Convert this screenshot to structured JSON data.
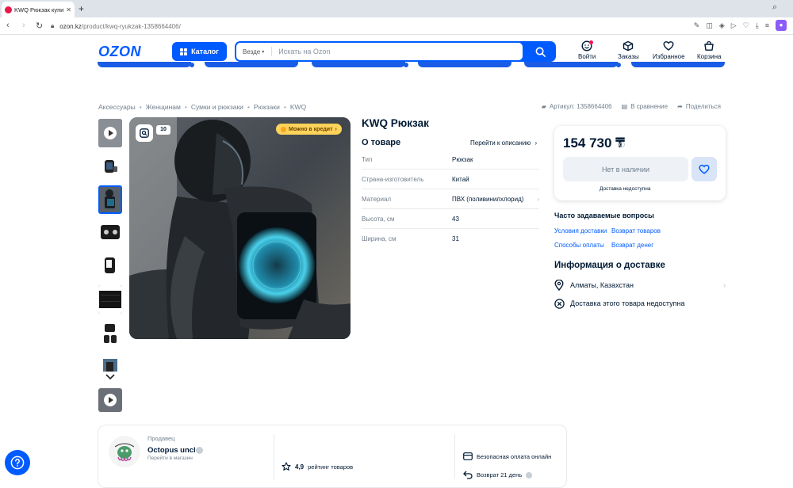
{
  "browser": {
    "tab_title": "KWQ Рюкзак купить на Ozon",
    "url_domain": "ozon.kz",
    "url_path": "/product/kwq-ryukzak-1358664406/"
  },
  "header": {
    "logo": "OZON",
    "catalog_label": "Каталог",
    "search_scope": "Везде",
    "search_placeholder": "Искать на Ozon",
    "nav": [
      {
        "label": "Войти",
        "icon": "user-icon"
      },
      {
        "label": "Заказы",
        "icon": "box-icon"
      },
      {
        "label": "Избранное",
        "icon": "heart-icon"
      },
      {
        "label": "Корзина",
        "icon": "cart-icon"
      }
    ]
  },
  "breadcrumbs": [
    "Аксессуары",
    "Женщинам",
    "Сумки и рюкзаки",
    "Рюкзаки",
    "KWQ"
  ],
  "top_actions": {
    "article": "Артикул: 1358664406",
    "compare": "В сравнение",
    "share": "Поделиться"
  },
  "gallery": {
    "credit_badge": "Можно в кредит",
    "ten_badge": "10"
  },
  "product": {
    "title": "KWQ Рюкзак",
    "about_title": "О товаре",
    "goto_description": "Перейти к описанию",
    "specs": [
      {
        "key": "Тип",
        "value": "Рюкзак"
      },
      {
        "key": "Страна-изготовитель",
        "value": "Китай"
      },
      {
        "key": "Материал",
        "value": "ПВХ (поливинилхлорид)"
      },
      {
        "key": "Высота, см",
        "value": "43"
      },
      {
        "key": "Ширина, см",
        "value": "31"
      }
    ]
  },
  "price_card": {
    "price": "154 730 ₸",
    "out_of_stock": "Нет в наличии",
    "delivery_unavailable": "Доставка недоступна"
  },
  "faq": {
    "title": "Часто задаваемые вопросы",
    "links": [
      "Условия доставки",
      "Возврат товаров",
      "Способы оплаты",
      "Возврат денег"
    ]
  },
  "delivery": {
    "title": "Информация о доставке",
    "city": "Алматы, Казахстан",
    "unavailable": "Доставка этого товара недоступна"
  },
  "seller": {
    "label": "Продавец",
    "name": "Octopus uncle",
    "link": "Перейти в магазин",
    "rating_value": "4,9",
    "rating_label": "рейтинг товаров",
    "safe_payment": "Безопасная оплата онлайн",
    "return": "Возврат 21 день"
  },
  "colors": {
    "brand": "#005bff",
    "text": "#001a34",
    "muted": "#707f8d"
  }
}
